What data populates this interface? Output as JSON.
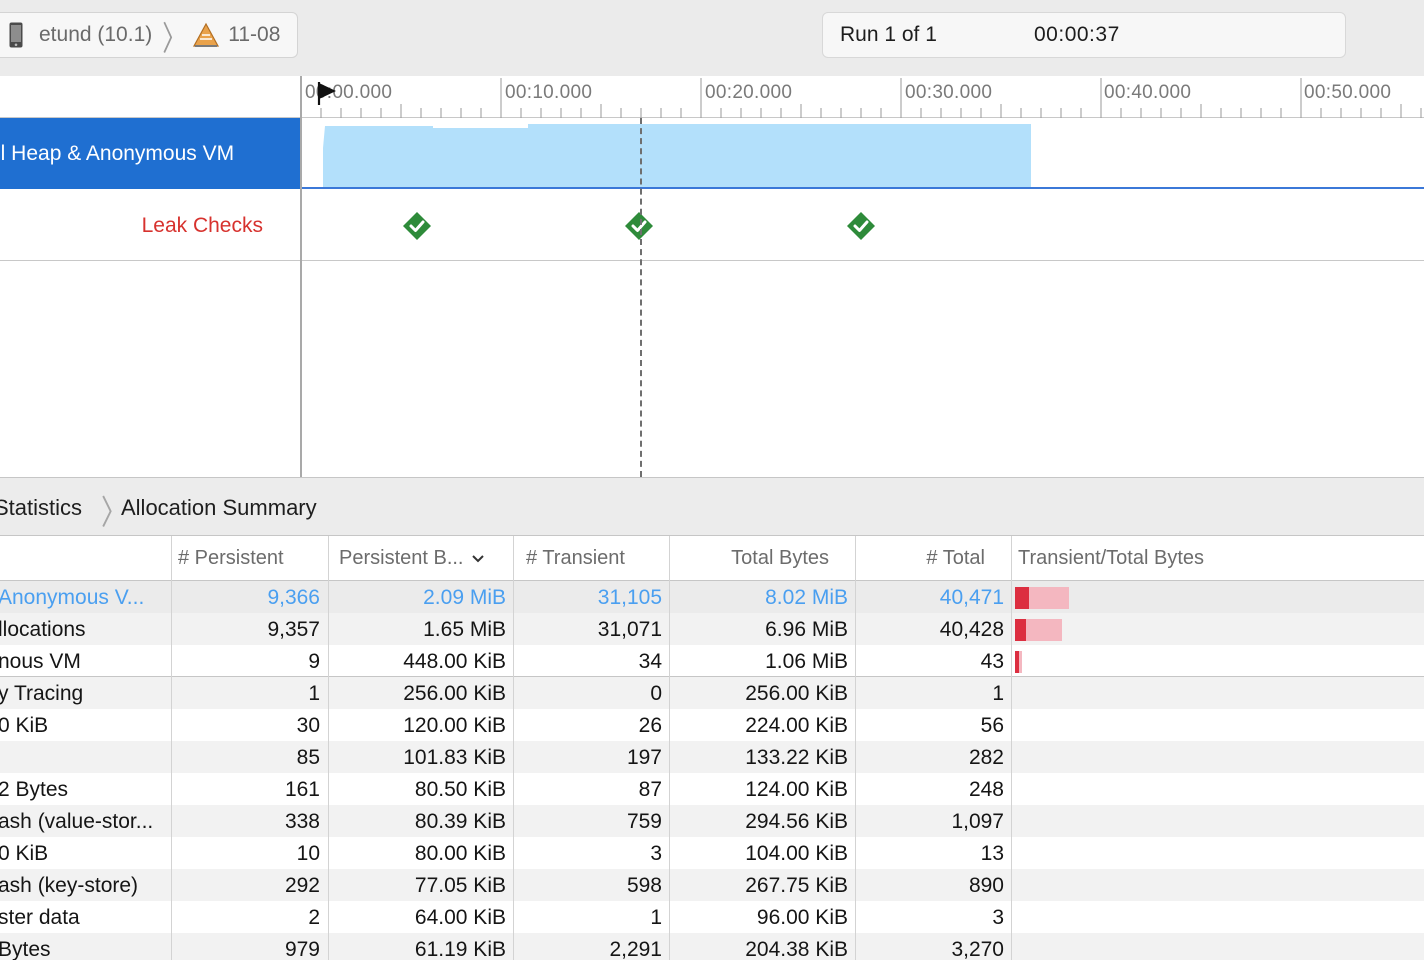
{
  "toolbar": {
    "scheme_device": "etund (10.1)",
    "scheme_target": "11-08",
    "run_label": "Run 1 of 1",
    "run_time": "00:00:37"
  },
  "timeline": {
    "ruler_labels": [
      "00:00.000",
      "00:10.000",
      "00:20.000",
      "00:30.000",
      "00:40.000",
      "00:50.000"
    ],
    "tracks": {
      "heap_label": "ll Heap & Anonymous VM",
      "leak_label": "Leak Checks"
    },
    "recording_end_seconds": 36.5,
    "leak_check_times_seconds": [
      5.8,
      16.9,
      28.0
    ],
    "inspection_time_seconds": 17.0
  },
  "detail": {
    "breadcrumb": [
      "Statistics",
      "Allocation Summary"
    ],
    "columns": [
      "# Persistent",
      "Persistent B...",
      "# Transient",
      "Total Bytes",
      "# Total",
      "Transient/Total Bytes"
    ],
    "rows": [
      {
        "category": " Anonymous V...",
        "persistent": "9,366",
        "persistent_bytes": "2.09 MiB",
        "transient": "31,105",
        "total_bytes": "8.02 MiB",
        "total": "40,471",
        "persistent_fraction": 0.26,
        "total_fraction": 0.9
      },
      {
        "category": "llocations",
        "persistent": "9,357",
        "persistent_bytes": "1.65 MiB",
        "transient": "31,071",
        "total_bytes": "6.96 MiB",
        "total": "40,428",
        "persistent_fraction": 0.24,
        "total_fraction": 0.78
      },
      {
        "category": "nous VM",
        "persistent": "9",
        "persistent_bytes": "448.00 KiB",
        "transient": "34",
        "total_bytes": "1.06 MiB",
        "total": "43",
        "persistent_fraction": 0.41,
        "total_fraction": 0.12
      },
      {
        "category": "y Tracing",
        "persistent": "1",
        "persistent_bytes": "256.00 KiB",
        "transient": "0",
        "total_bytes": "256.00 KiB",
        "total": "1"
      },
      {
        "category": "0 KiB",
        "persistent": "30",
        "persistent_bytes": "120.00 KiB",
        "transient": "26",
        "total_bytes": "224.00 KiB",
        "total": "56"
      },
      {
        "category": "",
        "persistent": "85",
        "persistent_bytes": "101.83 KiB",
        "transient": "197",
        "total_bytes": "133.22 KiB",
        "total": "282"
      },
      {
        "category": "2 Bytes",
        "persistent": "161",
        "persistent_bytes": "80.50 KiB",
        "transient": "87",
        "total_bytes": "124.00 KiB",
        "total": "248"
      },
      {
        "category": "ash (value-stor...",
        "persistent": "338",
        "persistent_bytes": "80.39 KiB",
        "transient": "759",
        "total_bytes": "294.56 KiB",
        "total": "1,097"
      },
      {
        "category": "0 KiB",
        "persistent": "10",
        "persistent_bytes": "80.00 KiB",
        "transient": "3",
        "total_bytes": "104.00 KiB",
        "total": "13"
      },
      {
        "category": "ash (key-store)",
        "persistent": "292",
        "persistent_bytes": "77.05 KiB",
        "transient": "598",
        "total_bytes": "267.75 KiB",
        "total": "890"
      },
      {
        "category": "ster data",
        "persistent": "2",
        "persistent_bytes": "64.00 KiB",
        "transient": "1",
        "total_bytes": "96.00 KiB",
        "total": "3"
      },
      {
        "category": "Bytes",
        "persistent": "979",
        "persistent_bytes": "61.19 KiB",
        "transient": "2,291",
        "total_bytes": "204.38 KiB",
        "total": "3,270"
      }
    ]
  },
  "colors": {
    "track_selected": "#1f6fd1",
    "heap_fill": "#b3e0fb",
    "leak_label": "#d7322e",
    "leak_check_ok": "#2e8b3a",
    "highlight_text": "#4a9ff0",
    "bar_transient": "#dc2e40",
    "bar_total": "#f4b7c0"
  },
  "icons": {
    "device": "iphone-icon",
    "target": "instruments-app-icon",
    "scheme_separator": "chevron-right-icon",
    "playhead": "playhead-flag-icon",
    "leak_check": "checkmark-diamond-icon",
    "sort": "chevron-down-icon"
  }
}
